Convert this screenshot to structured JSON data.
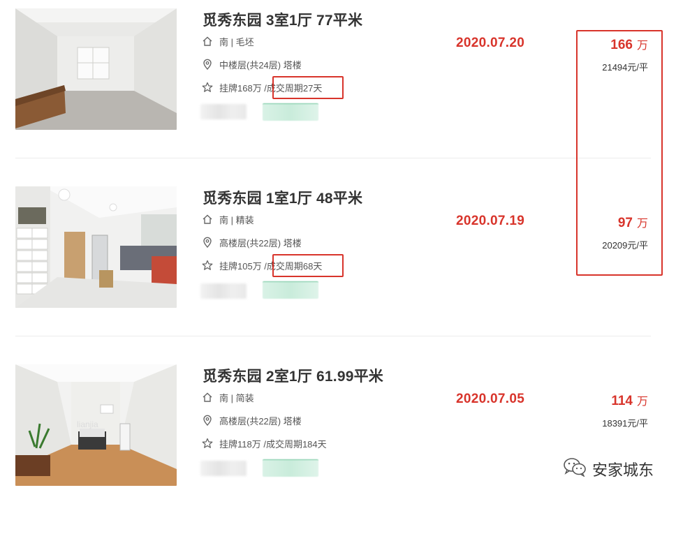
{
  "colors": {
    "accent": "#d8342b",
    "tag_green": "#6cc49a"
  },
  "listings": [
    {
      "title": "觅秀东园 3室1厅 77平米",
      "orientation_decor": "南 | 毛坯",
      "floor_building": "中楼层(共24层) 塔楼",
      "listing_price": "挂牌168万 / ",
      "deal_cycle": "成交周期27天",
      "deal_date": "2020.07.20",
      "total_price": "166",
      "total_unit": "万",
      "unit_price": "21494元/平",
      "icons": [
        "house-icon",
        "location-pin-icon",
        "star-icon"
      ]
    },
    {
      "title": "觅秀东园 1室1厅 48平米",
      "orientation_decor": "南 | 精装",
      "floor_building": "高楼层(共22层) 塔楼",
      "listing_price": "挂牌105万 / ",
      "deal_cycle": "成交周期68天",
      "deal_date": "2020.07.19",
      "total_price": "97",
      "total_unit": "万",
      "unit_price": "20209元/平",
      "icons": [
        "house-icon",
        "location-pin-icon",
        "star-icon"
      ]
    },
    {
      "title": "觅秀东园 2室1厅 61.99平米",
      "orientation_decor": "南 | 简装",
      "floor_building": "高楼层(共22层) 塔楼",
      "listing_price": "挂牌118万 / ",
      "deal_cycle": "成交周期184天",
      "deal_date": "2020.07.05",
      "total_price": "114",
      "total_unit": "万",
      "unit_price": "18391元/平",
      "icons": [
        "house-icon",
        "location-pin-icon",
        "star-icon"
      ]
    }
  ],
  "photo_watermark": "lianjia",
  "watermark": {
    "text": "安家城东",
    "icon": "wechat-icon"
  }
}
